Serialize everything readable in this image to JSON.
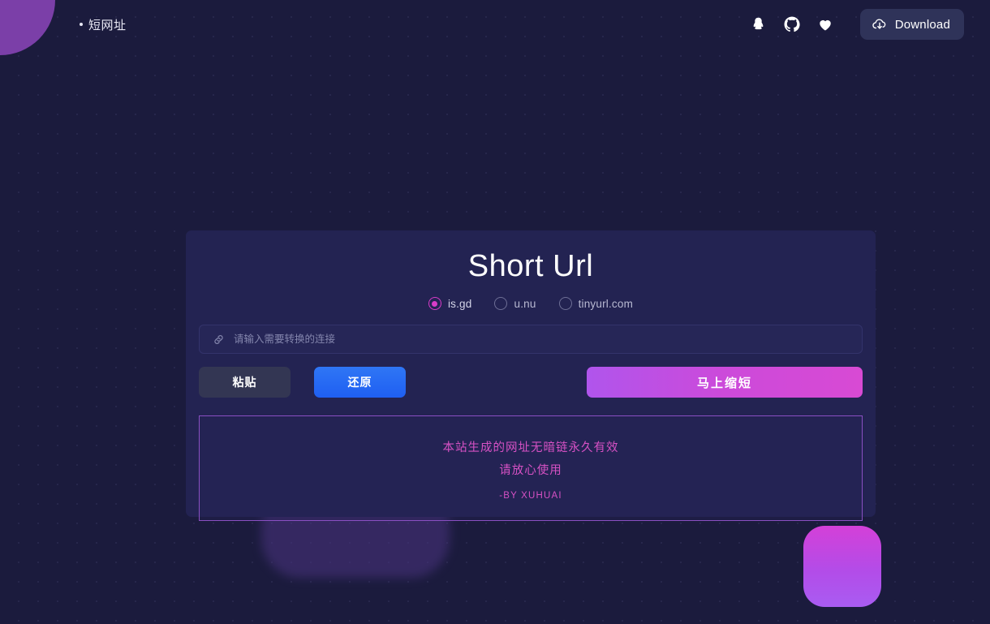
{
  "header": {
    "brand": "短网址",
    "icons": [
      {
        "name": "qq-icon",
        "title": "QQ"
      },
      {
        "name": "github-icon",
        "title": "GitHub"
      },
      {
        "name": "heart-icon",
        "title": "Favorite"
      }
    ],
    "download_label": "Download",
    "download_icon": "cloud-download-icon"
  },
  "card": {
    "title": "Short Url",
    "services": [
      {
        "label": "is.gd",
        "selected": true
      },
      {
        "label": "u.nu",
        "selected": false
      },
      {
        "label": "tinyurl.com",
        "selected": false
      }
    ],
    "input": {
      "icon": "link-icon",
      "value": "",
      "placeholder": "请输入需要转换的连接"
    },
    "buttons": {
      "paste": "粘贴",
      "restore": "还原",
      "shorten": "马上缩短"
    },
    "notice": {
      "line1": "本站生成的网址无暗链永久有效",
      "line2": "请放心使用",
      "signature": "-BY XUHUAI"
    }
  },
  "colors": {
    "page_bg": "#1b1b3d",
    "card_bg": "#232352",
    "accent_pink": "#d83cc8",
    "accent_purple": "#7b3fa8",
    "accent_blue": "#2f76f5",
    "notice_border": "#8a4fc2"
  }
}
